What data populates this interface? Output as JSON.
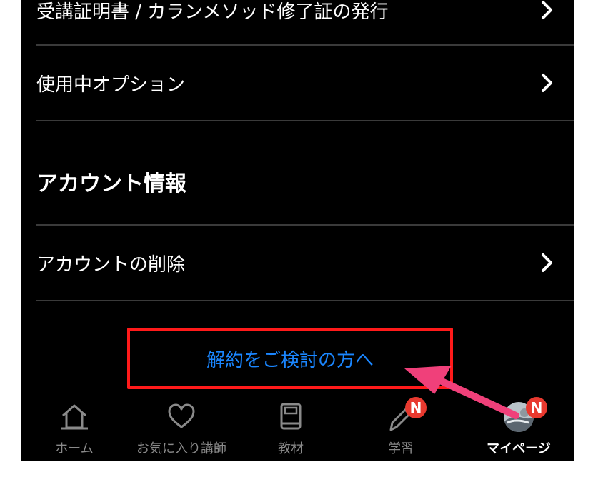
{
  "menu": {
    "certificate_label": "受講証明書 / カランメソッド修了証の発行",
    "options_label": "使用中オプション",
    "account_section_title": "アカウント情報",
    "delete_account_label": "アカウントの削除"
  },
  "cancel_link_label": "解約をご検討の方へ",
  "tabs": [
    {
      "label": "ホーム",
      "icon": "home-icon"
    },
    {
      "label": "お気に入り講師",
      "icon": "heart-icon"
    },
    {
      "label": "教材",
      "icon": "book-icon"
    },
    {
      "label": "学習",
      "icon": "pencil-icon",
      "badge": "N"
    },
    {
      "label": "マイページ",
      "icon": "avatar",
      "badge": "N"
    }
  ],
  "colors": {
    "background": "#000000",
    "link": "#1a86ff",
    "highlight_box": "#ff1a1a",
    "badge": "#e8392f",
    "annotation_arrow": "#f0407a"
  }
}
